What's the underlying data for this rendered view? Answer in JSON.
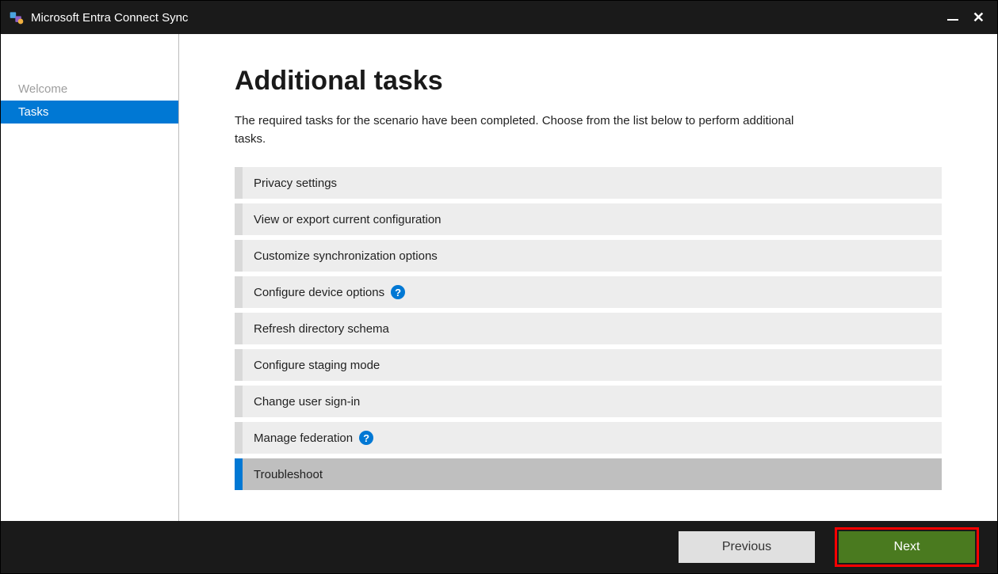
{
  "titlebar": {
    "title": "Microsoft Entra Connect Sync"
  },
  "sidebar": {
    "items": [
      {
        "label": "Welcome",
        "active": false
      },
      {
        "label": "Tasks",
        "active": true
      }
    ]
  },
  "main": {
    "title": "Additional tasks",
    "description": "The required tasks for the scenario have been completed. Choose from the list below to perform additional tasks.",
    "tasks": [
      {
        "label": "Privacy settings",
        "help": false,
        "selected": false
      },
      {
        "label": "View or export current configuration",
        "help": false,
        "selected": false
      },
      {
        "label": "Customize synchronization options",
        "help": false,
        "selected": false
      },
      {
        "label": "Configure device options",
        "help": true,
        "selected": false
      },
      {
        "label": "Refresh directory schema",
        "help": false,
        "selected": false
      },
      {
        "label": "Configure staging mode",
        "help": false,
        "selected": false
      },
      {
        "label": "Change user sign-in",
        "help": false,
        "selected": false
      },
      {
        "label": "Manage federation",
        "help": true,
        "selected": false
      },
      {
        "label": "Troubleshoot",
        "help": false,
        "selected": true
      }
    ]
  },
  "footer": {
    "previous": "Previous",
    "next": "Next"
  }
}
